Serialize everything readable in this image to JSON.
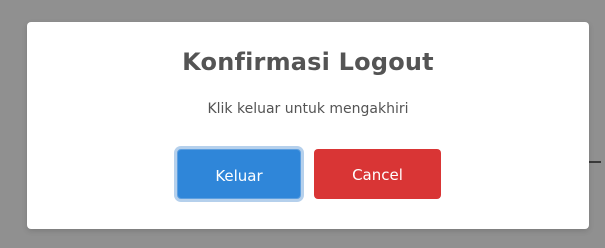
{
  "dialog": {
    "title": "Konfirmasi Logout",
    "message": "Klik keluar untuk mengakhiri",
    "confirm_label": "Keluar",
    "cancel_label": "Cancel"
  },
  "colors": {
    "overlay": "#8f8f8f",
    "modal_background": "#ffffff",
    "text": "#545454",
    "confirm_button": "#2f86d9",
    "cancel_button": "#d93535"
  }
}
